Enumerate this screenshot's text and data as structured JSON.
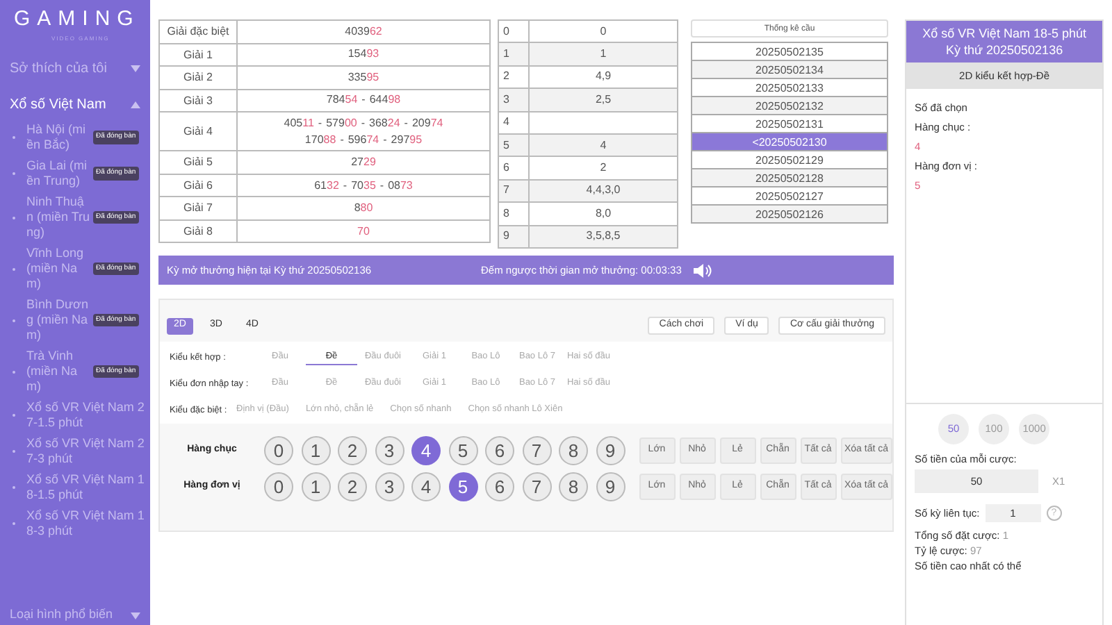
{
  "sidebar": {
    "logo": "GAMING",
    "logo_sub": "VIDEO GAMING",
    "sections": [
      {
        "label": "Sở thích của tôi",
        "expanded": false
      },
      {
        "label": "Xổ số Việt Nam",
        "expanded": true
      }
    ],
    "items": [
      {
        "label": "Hà Nội (miền Bắc)",
        "badge": "Đã đóng bàn"
      },
      {
        "label": "Gia Lai (miền Trung)",
        "badge": "Đã đóng bàn"
      },
      {
        "label": "Ninh Thuận (miền Trung)",
        "badge": "Đã đóng bàn"
      },
      {
        "label": "Vĩnh Long (miền Nam)",
        "badge": "Đã đóng bàn"
      },
      {
        "label": "Bình Dương (miền Nam)",
        "badge": "Đã đóng bàn"
      },
      {
        "label": "Trà Vinh (miền Nam)",
        "badge": "Đã đóng bàn"
      },
      {
        "label": "Xổ số VR Việt Nam 27-1.5 phút"
      },
      {
        "label": "Xổ số VR Việt Nam 27-3 phút"
      },
      {
        "label": "Xổ số VR Việt Nam 18-1.5 phút"
      },
      {
        "label": "Xổ số VR Việt Nam 18-3 phút"
      }
    ],
    "footer": {
      "label": "Loại hình phổ biến",
      "expanded": false
    }
  },
  "results": [
    {
      "prize": "Giải đặc biệt",
      "lines": [
        [
          {
            "head": "4039",
            "tail": "62"
          }
        ]
      ]
    },
    {
      "prize": "Giải 1",
      "lines": [
        [
          {
            "head": "154",
            "tail": "93"
          }
        ]
      ]
    },
    {
      "prize": "Giải 2",
      "lines": [
        [
          {
            "head": "335",
            "tail": "95"
          }
        ]
      ]
    },
    {
      "prize": "Giải 3",
      "lines": [
        [
          {
            "head": "784",
            "tail": "54"
          },
          {
            "head": "644",
            "tail": "98"
          }
        ]
      ]
    },
    {
      "prize": "Giải 4",
      "lines": [
        [
          {
            "head": "405",
            "tail": "11"
          },
          {
            "head": "579",
            "tail": "00"
          },
          {
            "head": "368",
            "tail": "24"
          },
          {
            "head": "209",
            "tail": "74"
          }
        ],
        [
          {
            "head": "170",
            "tail": "88"
          },
          {
            "head": "596",
            "tail": "74"
          },
          {
            "head": "297",
            "tail": "95"
          }
        ]
      ]
    },
    {
      "prize": "Giải 5",
      "lines": [
        [
          {
            "head": "27",
            "tail": "29"
          }
        ]
      ]
    },
    {
      "prize": "Giải 6",
      "lines": [
        [
          {
            "head": "61",
            "tail": "32"
          },
          {
            "head": "70",
            "tail": "35"
          },
          {
            "head": "08",
            "tail": "73"
          }
        ]
      ]
    },
    {
      "prize": "Giải 7",
      "lines": [
        [
          {
            "head": "8",
            "tail": "80"
          }
        ]
      ]
    },
    {
      "prize": "Giải 8",
      "lines": [
        [
          {
            "tail": "70"
          }
        ]
      ]
    }
  ],
  "results_separator": "-",
  "digit_table": [
    {
      "digit": "0",
      "values": "0"
    },
    {
      "digit": "1",
      "values": "1"
    },
    {
      "digit": "2",
      "values": "4,9"
    },
    {
      "digit": "3",
      "values": "2,5"
    },
    {
      "digit": "4"
    },
    {
      "digit": "5",
      "values": "4"
    },
    {
      "digit": "6",
      "values": "2"
    },
    {
      "digit": "7",
      "values": "4,4,3,0"
    },
    {
      "digit": "8",
      "values": "8,0"
    },
    {
      "digit": "9",
      "values": "3,5,8,5"
    }
  ],
  "stats": {
    "title": "Thống kê cầu",
    "periods": [
      {
        "label": "20250502135",
        "selected": false
      },
      {
        "label": "20250502134",
        "selected": false
      },
      {
        "label": "20250502133",
        "selected": false
      },
      {
        "label": "20250502132",
        "selected": false
      },
      {
        "label": "20250502131",
        "selected": false
      },
      {
        "label": "<20250502130",
        "selected": true
      },
      {
        "label": "20250502129",
        "selected": false
      },
      {
        "label": "20250502128",
        "selected": false
      },
      {
        "label": "20250502127",
        "selected": false
      },
      {
        "label": "20250502126",
        "selected": false
      }
    ]
  },
  "banner": {
    "current": "Kỳ mở thưởng hiện tại Kỳ thứ 20250502136",
    "countdown": "Đếm ngược thời gian mở thưởng: 00:03:33"
  },
  "modes": [
    {
      "label": "2D",
      "selected": true
    },
    {
      "label": "3D",
      "selected": false
    },
    {
      "label": "4D",
      "selected": false
    }
  ],
  "actions": [
    "Cách chơi",
    "Ví dụ",
    "Cơ cấu giải thưởng"
  ],
  "bet_types": [
    {
      "label": "Kiểu kết hợp :",
      "options": [
        {
          "label": "Đầu",
          "selected": false
        },
        {
          "label": "Đề",
          "selected": true
        },
        {
          "label": "Đầu đuôi",
          "selected": false
        },
        {
          "label": "Giải 1",
          "selected": false
        },
        {
          "label": "Bao Lô",
          "selected": false
        },
        {
          "label": "Bao Lô 7",
          "selected": false
        },
        {
          "label": "Hai số đầu",
          "selected": false
        }
      ]
    },
    {
      "label": "Kiểu đơn nhập tay :",
      "options": [
        {
          "label": "Đầu",
          "selected": false
        },
        {
          "label": "Đề",
          "selected": false
        },
        {
          "label": "Đầu đuôi",
          "selected": false
        },
        {
          "label": "Giải 1",
          "selected": false
        },
        {
          "label": "Bao Lô",
          "selected": false
        },
        {
          "label": "Bao Lô 7",
          "selected": false
        },
        {
          "label": "Hai số đầu",
          "selected": false
        }
      ]
    },
    {
      "label": "Kiểu đặc biệt :",
      "options": [
        {
          "label": "Định vị (Đầu)",
          "selected": false
        },
        {
          "label": "Lớn nhỏ, chẵn lẻ",
          "selected": false
        },
        {
          "label": "Chọn số nhanh",
          "selected": false
        },
        {
          "label": "Chọn số nhanh Lô Xiên",
          "selected": false
        }
      ]
    }
  ],
  "picker_rows": [
    {
      "label": "Hàng chục",
      "digits": [
        {
          "label": "0",
          "selected": false
        },
        {
          "label": "1",
          "selected": false
        },
        {
          "label": "2",
          "selected": false
        },
        {
          "label": "3",
          "selected": false
        },
        {
          "label": "4",
          "selected": true
        },
        {
          "label": "5",
          "selected": false
        },
        {
          "label": "6",
          "selected": false
        },
        {
          "label": "7",
          "selected": false
        },
        {
          "label": "8",
          "selected": false
        },
        {
          "label": "9",
          "selected": false
        }
      ],
      "quick": [
        "Lớn",
        "Nhỏ",
        "Lẻ",
        "Chẵn",
        "Tất cả",
        "Xóa tất cả"
      ]
    },
    {
      "label": "Hàng đơn vị",
      "digits": [
        {
          "label": "0",
          "selected": false
        },
        {
          "label": "1",
          "selected": false
        },
        {
          "label": "2",
          "selected": false
        },
        {
          "label": "3",
          "selected": false
        },
        {
          "label": "4",
          "selected": false
        },
        {
          "label": "5",
          "selected": true
        },
        {
          "label": "6",
          "selected": false
        },
        {
          "label": "7",
          "selected": false
        },
        {
          "label": "8",
          "selected": false
        },
        {
          "label": "9",
          "selected": false
        }
      ],
      "quick": [
        "Lớn",
        "Nhỏ",
        "Lẻ",
        "Chẵn",
        "Tất cả",
        "Xóa tất cả"
      ]
    }
  ],
  "slip": {
    "game": "Xổ số VR Việt Nam 18-5 phút",
    "period": "Kỳ thứ 20250502136",
    "bet_type": "2D kiểu kết hợp-Đề",
    "chosen_title": "Số đã chọn",
    "chosen": [
      {
        "label": "Hàng chục :",
        "value": "4"
      },
      {
        "label": "Hàng đơn vị :",
        "value": "5"
      }
    ],
    "chips": [
      {
        "label": "50",
        "selected": true
      },
      {
        "label": "100",
        "selected": false
      },
      {
        "label": "1000",
        "selected": false
      }
    ],
    "amount_label": "Số tiền của mỗi cược:",
    "amount": "50",
    "multiplier": "X1",
    "periods_label": "Số kỳ liên tục:",
    "periods": "1",
    "help": "?",
    "total_label": "Tổng số đặt cược:",
    "total": "1",
    "odds_label": "Tỷ lệ cược:",
    "odds": "97",
    "max_win_label": "Số tiền cao nhất có thể"
  }
}
